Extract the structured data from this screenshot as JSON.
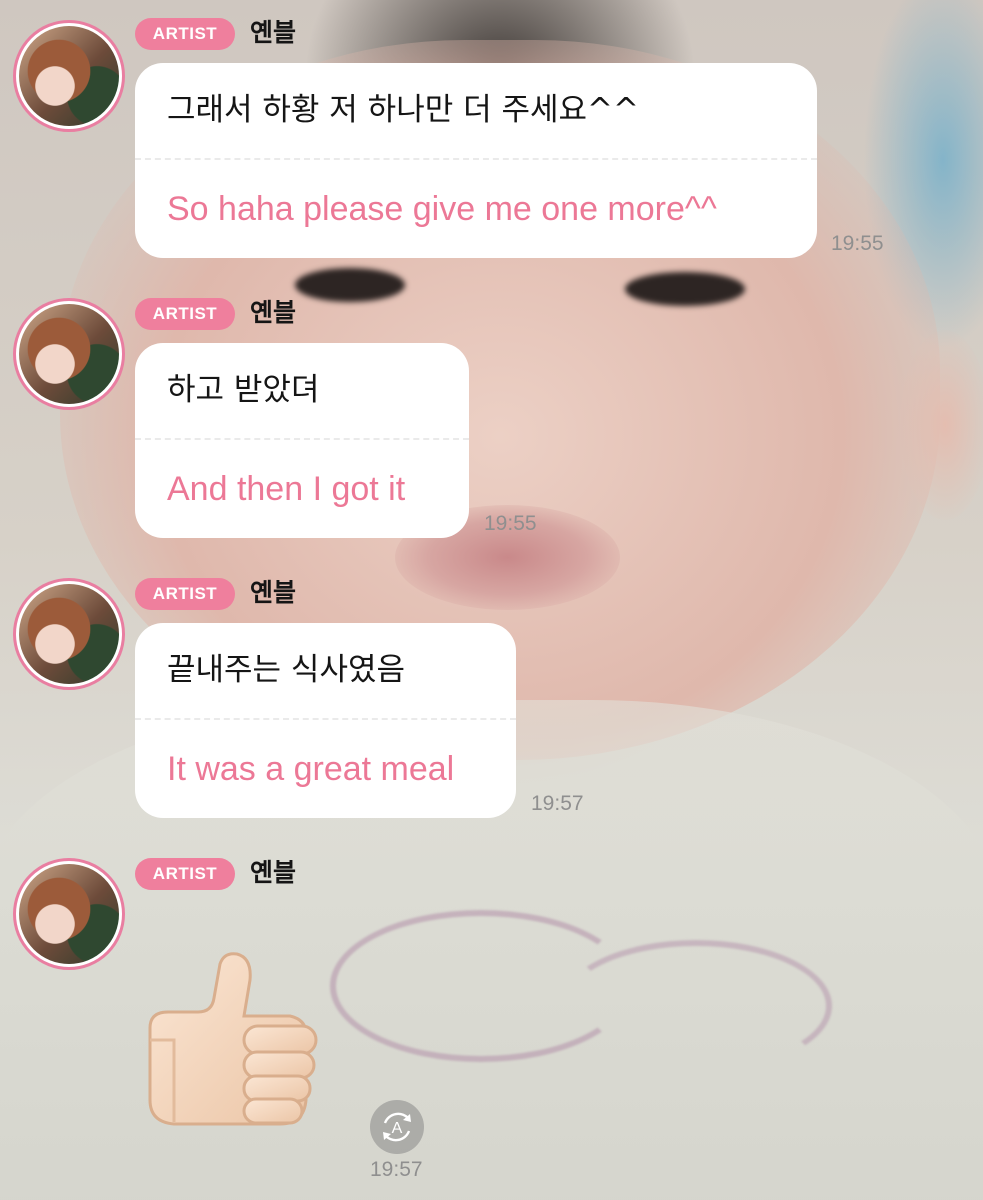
{
  "messages": [
    {
      "badge": "ARTIST",
      "sender": "옌블",
      "original": "그래서 하황 저 하나만 더 주세요^^",
      "translation": "So haha please give me one more^^",
      "time": "19:55"
    },
    {
      "badge": "ARTIST",
      "sender": "옌블",
      "original": "하고 받았뎌",
      "translation": "And then I got it",
      "time": "19:55"
    },
    {
      "badge": "ARTIST",
      "sender": "옌블",
      "original": "끝내주는 식사였음",
      "translation": "It was a great meal",
      "time": "19:57"
    },
    {
      "badge": "ARTIST",
      "sender": "옌블",
      "emoji": "thumbs-up",
      "time": "19:57"
    }
  ],
  "colors": {
    "badge": "#ef7f9d",
    "translation_text": "#ec7896",
    "avatar_ring": "#e97ea1",
    "bubble": "#ffffff",
    "timestamp": "#8f8f8f"
  },
  "icons": {
    "translate_button": "auto-translate-icon",
    "sticker": "thumbs-up-icon"
  }
}
